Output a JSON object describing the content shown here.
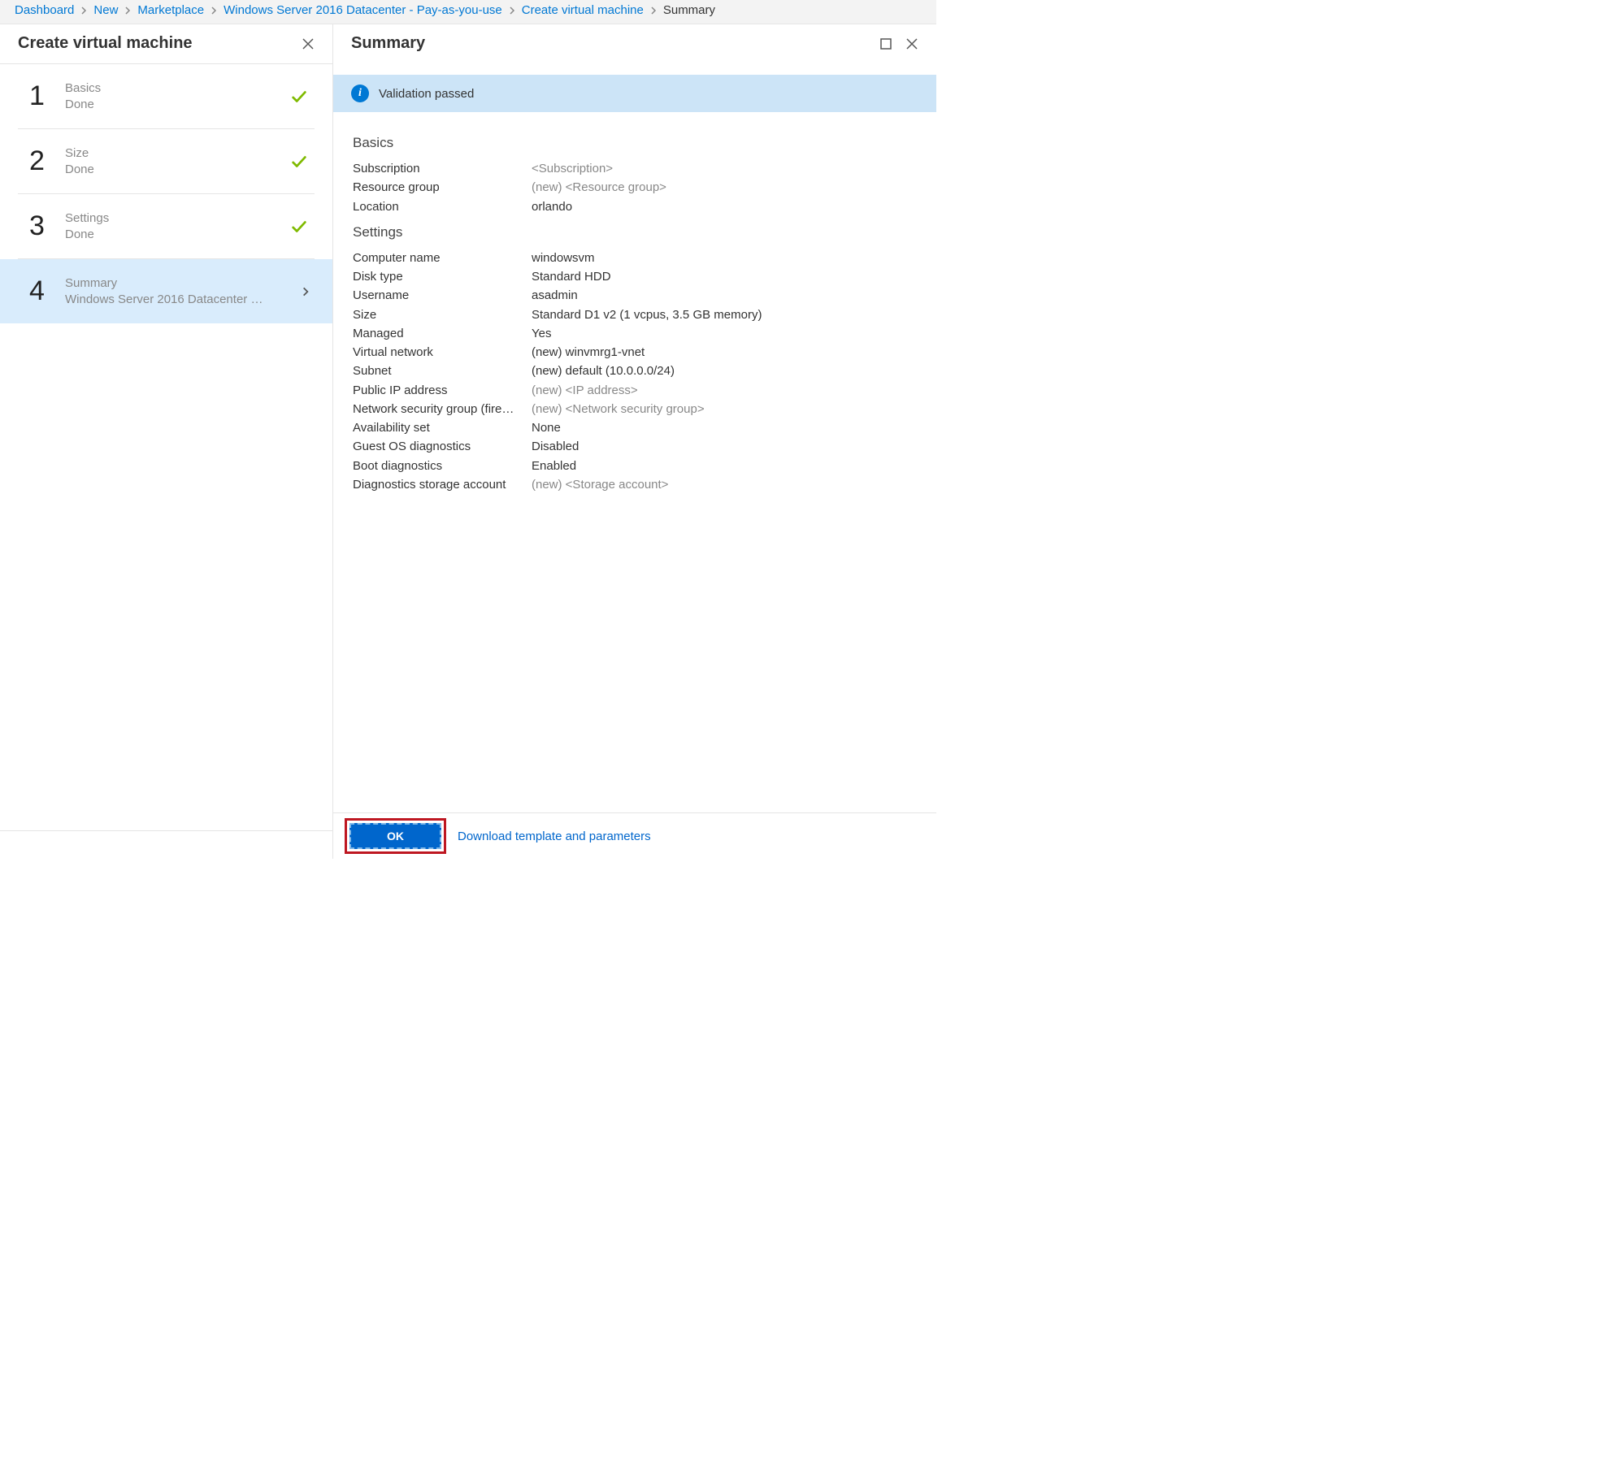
{
  "breadcrumbs": [
    {
      "label": "Dashboard",
      "current": false
    },
    {
      "label": "New",
      "current": false
    },
    {
      "label": "Marketplace",
      "current": false
    },
    {
      "label": "Windows Server 2016 Datacenter - Pay-as-you-use",
      "current": false
    },
    {
      "label": "Create virtual machine",
      "current": false
    },
    {
      "label": "Summary",
      "current": true
    }
  ],
  "left": {
    "title": "Create virtual machine",
    "steps": [
      {
        "num": "1",
        "title": "Basics",
        "sub": "Done",
        "state": "done"
      },
      {
        "num": "2",
        "title": "Size",
        "sub": "Done",
        "state": "done"
      },
      {
        "num": "3",
        "title": "Settings",
        "sub": "Done",
        "state": "done"
      },
      {
        "num": "4",
        "title": "Summary",
        "sub": "Windows Server 2016 Datacenter …",
        "state": "active"
      }
    ]
  },
  "right": {
    "title": "Summary",
    "validation": "Validation passed",
    "sections": [
      {
        "title": "Basics",
        "rows": [
          {
            "k": "Subscription",
            "v": "<Subscription>",
            "muted": true
          },
          {
            "k": "Resource group",
            "v": "(new)  <Resource group>",
            "muted": true
          },
          {
            "k": "Location",
            "v": "orlando"
          }
        ]
      },
      {
        "title": "Settings",
        "rows": [
          {
            "k": "Computer name",
            "v": "windowsvm"
          },
          {
            "k": "Disk type",
            "v": "Standard HDD"
          },
          {
            "k": "Username",
            "v": "asadmin"
          },
          {
            "k": "Size",
            "v": "Standard D1 v2 (1 vcpus, 3.5 GB memory)"
          },
          {
            "k": "Managed",
            "v": "Yes"
          },
          {
            "k": "Virtual network",
            "v": "(new) winvmrg1-vnet"
          },
          {
            "k": "Subnet",
            "v": "(new) default (10.0.0.0/24)"
          },
          {
            "k": "Public IP address",
            "v": "(new)  <IP address>",
            "muted": true
          },
          {
            "k": "Network security group (fire…",
            "v": "(new)  <Network security group>",
            "muted": true
          },
          {
            "k": "Availability set",
            "v": "None"
          },
          {
            "k": "Guest OS diagnostics",
            "v": "Disabled"
          },
          {
            "k": "Boot diagnostics",
            "v": "Enabled"
          },
          {
            "k": "Diagnostics storage account",
            "v": "(new)  <Storage account>",
            "muted": true
          }
        ]
      }
    ],
    "footer": {
      "ok": "OK",
      "download": "Download template and parameters"
    }
  }
}
